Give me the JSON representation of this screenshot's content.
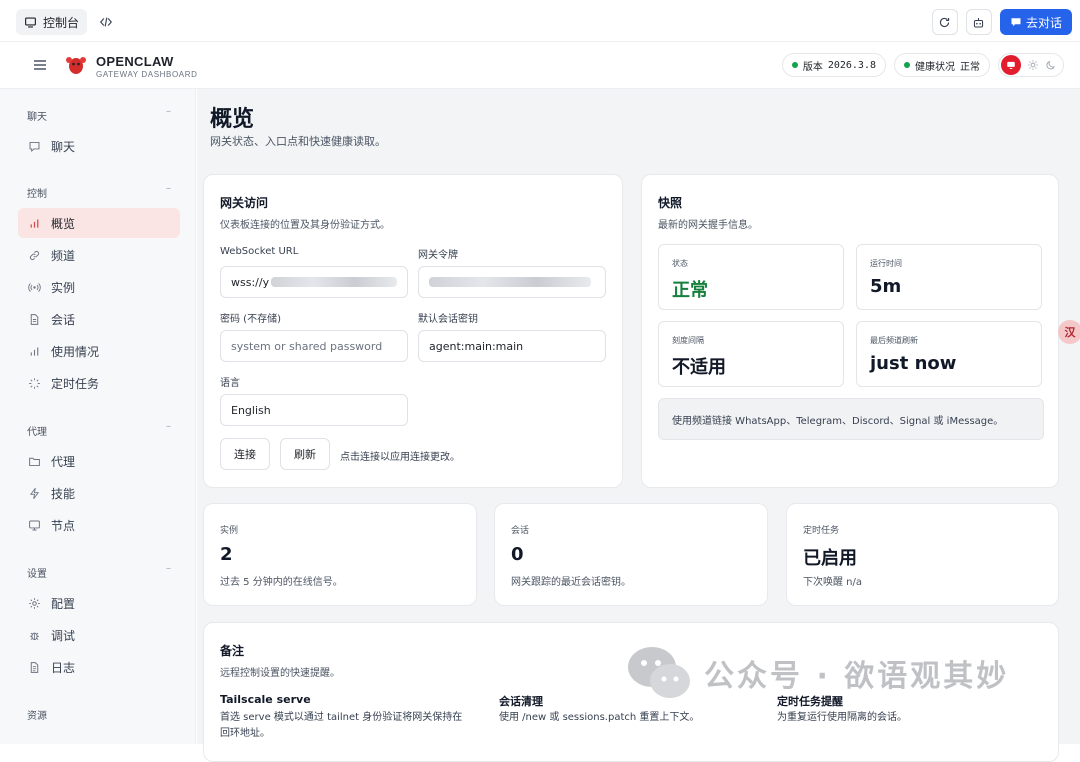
{
  "topbar": {
    "console_label": "控制台",
    "chat_button": "去对话"
  },
  "header": {
    "brand_name": "OPENCLAW",
    "brand_sub": "GATEWAY DASHBOARD",
    "version_label": "版本",
    "version_value": "2026.3.8",
    "health_label": "健康状况",
    "health_value": "正常"
  },
  "sidebar": {
    "sections": [
      {
        "title": "聊天",
        "items": [
          {
            "label": "聊天",
            "icon": "message-icon"
          }
        ]
      },
      {
        "title": "控制",
        "items": [
          {
            "label": "概览",
            "icon": "bar-chart-icon",
            "active": true
          },
          {
            "label": "频道",
            "icon": "link-icon"
          },
          {
            "label": "实例",
            "icon": "radio-icon"
          },
          {
            "label": "会话",
            "icon": "document-icon"
          },
          {
            "label": "使用情况",
            "icon": "bar-chart-icon"
          },
          {
            "label": "定时任务",
            "icon": "loader-icon"
          }
        ]
      },
      {
        "title": "代理",
        "items": [
          {
            "label": "代理",
            "icon": "folder-icon"
          },
          {
            "label": "技能",
            "icon": "zap-icon"
          },
          {
            "label": "节点",
            "icon": "monitor-icon"
          }
        ]
      },
      {
        "title": "设置",
        "items": [
          {
            "label": "配置",
            "icon": "gear-icon"
          },
          {
            "label": "调试",
            "icon": "bug-icon"
          },
          {
            "label": "日志",
            "icon": "file-text-icon"
          }
        ]
      },
      {
        "title": "资源",
        "items": []
      }
    ]
  },
  "page": {
    "title": "概览",
    "subtitle": "网关状态、入口点和快速健康读取。"
  },
  "gateway_access": {
    "title": "网关访问",
    "subtitle": "仪表板连接的位置及其身份验证方式。",
    "ws_label": "WebSocket URL",
    "ws_value_prefix": "wss://y",
    "token_label": "网关令牌",
    "password_label": "密码 (不存储)",
    "password_placeholder": "system or shared password",
    "session_key_label": "默认会话密钥",
    "session_key_value": "agent:main:main",
    "language_label": "语言",
    "language_value": "English",
    "connect_button": "连接",
    "refresh_button": "刷新",
    "hint": "点击连接以应用连接更改。"
  },
  "snapshot": {
    "title": "快照",
    "subtitle": "最新的网关握手信息。",
    "stats": [
      {
        "label": "状态",
        "value": "正常"
      },
      {
        "label": "运行时间",
        "value": "5m"
      },
      {
        "label": "刻度间隔",
        "value": "不适用"
      },
      {
        "label": "最后频道刷新",
        "value": "just now"
      }
    ],
    "notice": "使用频道链接 WhatsApp、Telegram、Discord、Signal 或 iMessage。"
  },
  "metrics": [
    {
      "label": "实例",
      "value": "2",
      "sub": "过去 5 分钟内的在线信号。"
    },
    {
      "label": "会话",
      "value": "0",
      "sub": "网关跟踪的最近会话密钥。"
    },
    {
      "label": "定时任务",
      "value": "已启用",
      "sub": "下次唤醒 n/a"
    }
  ],
  "notes": {
    "title": "备注",
    "subtitle": "远程控制设置的快速提醒。",
    "items": [
      {
        "title": "Tailscale serve",
        "line1": "首选 serve 模式以通过 tailnet 身份验证将网关保持在",
        "line2": "回环地址。"
      },
      {
        "title": "会话清理",
        "line1": "使用 /new 或 sessions.patch 重置上下文。"
      },
      {
        "title": "定时任务提醒",
        "line1": "为重复运行使用隔离的会话。"
      }
    ]
  },
  "watermark": "公众号 · 欲语观其妙",
  "float_badge": "汉",
  "colors": {
    "accent": "#2563eb",
    "brand_red": "#e11d2e",
    "ok_green": "#15803d",
    "active_nav": "#fbe4e4"
  }
}
